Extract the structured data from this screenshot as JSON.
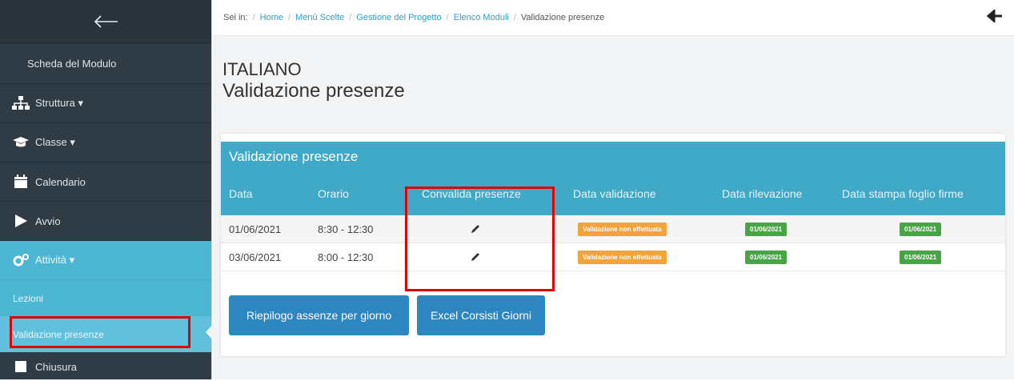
{
  "sidebar": {
    "items": [
      {
        "label": "Scheda del Modulo",
        "icon": "none"
      },
      {
        "label": "Struttura ▾",
        "icon": "sitemap-icon"
      },
      {
        "label": "Classe ▾",
        "icon": "graduation-cap-icon"
      },
      {
        "label": "Calendario",
        "icon": "calendar-icon"
      },
      {
        "label": "Avvio",
        "icon": "play-icon"
      },
      {
        "label": "Attività ▾",
        "icon": "gears-icon"
      }
    ],
    "subitems": [
      {
        "label": "Lezioni"
      },
      {
        "label": "Validazione presenze"
      }
    ],
    "last_item": {
      "label": "Chiusura",
      "icon": "square-icon"
    }
  },
  "breadcrumb": {
    "prefix": "Sei in:",
    "links": [
      "Home",
      "Menù Scelte",
      "Gestione del Progetto",
      "Elenco Moduli"
    ],
    "current": "Validazione presenze"
  },
  "page": {
    "title_line1": "ITALIANO",
    "title_line2": "Validazione presenze"
  },
  "panel": {
    "title": "Validazione presenze",
    "columns": [
      "Data",
      "Orario",
      "Convalida presenze",
      "Data validazione",
      "Data rilevazione",
      "Data stampa foglio firme"
    ],
    "rows": [
      {
        "data": "01/06/2021",
        "orario": "8:30 - 12:30",
        "validazione": "Validazione non effettuata",
        "rilevazione": "01/06/2021",
        "stampa": "01/06/2021"
      },
      {
        "data": "03/06/2021",
        "orario": "8:00 - 12:30",
        "validazione": "Validazione non effettuata",
        "rilevazione": "01/06/2021",
        "stampa": "01/06/2021"
      }
    ]
  },
  "buttons": {
    "riepilogo": "Riepilogo assenze per giorno",
    "excel": "Excel Corsisti Giorni"
  },
  "colors": {
    "sidebar": "#2f3b45",
    "accent": "#3fa9c7",
    "button": "#2e86c1",
    "badge_orange": "#f0a43a",
    "badge_green": "#49a447",
    "highlight": "#e00000"
  }
}
